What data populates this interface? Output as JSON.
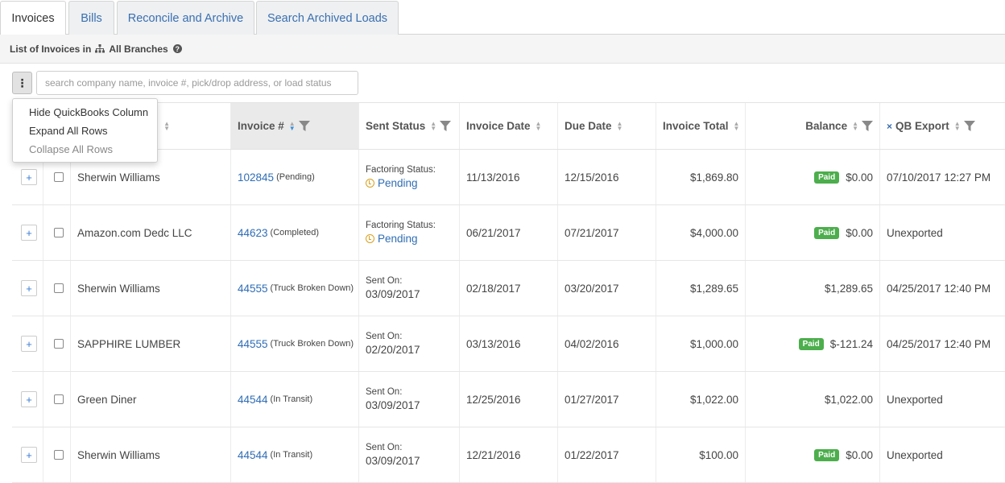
{
  "tabs": [
    {
      "label": "Invoices"
    },
    {
      "label": "Bills"
    },
    {
      "label": "Reconcile and Archive"
    },
    {
      "label": "Search Archived Loads"
    }
  ],
  "subheader": {
    "prefix": "List of Invoices in",
    "scope": "All Branches",
    "help": "?"
  },
  "search": {
    "placeholder": "search company name, invoice #, pick/drop address, or load status"
  },
  "menu_button": {
    "glyph": "⋮"
  },
  "dropdown": {
    "items": [
      {
        "label": "Hide QuickBooks Column"
      },
      {
        "label": "Expand All Rows"
      },
      {
        "label": "Collapse All Rows"
      }
    ]
  },
  "columns": {
    "invoice_num": "Invoice #",
    "sent_status": "Sent Status",
    "invoice_date": "Invoice Date",
    "due_date": "Due Date",
    "invoice_total": "Invoice Total",
    "balance": "Balance",
    "qb_export": "QB Export",
    "qb_remove": "×"
  },
  "rows": [
    {
      "company": "Sherwin Williams",
      "invoice": "102845",
      "invoice_status": "(Pending)",
      "sent_label": "Factoring Status:",
      "sent_value": "Pending",
      "sent_is_pending": true,
      "invoice_date": "11/13/2016",
      "due_date": "12/15/2016",
      "total": "$1,869.80",
      "paid": true,
      "paid_label": "Paid",
      "balance": "$0.00",
      "qb": "07/10/2017 12:27 PM"
    },
    {
      "company": "Amazon.com Dedc LLC",
      "invoice": "44623",
      "invoice_status": "(Completed)",
      "sent_label": "Factoring Status:",
      "sent_value": "Pending",
      "sent_is_pending": true,
      "invoice_date": "06/21/2017",
      "due_date": "07/21/2017",
      "total": "$4,000.00",
      "paid": true,
      "paid_label": "Paid",
      "balance": "$0.00",
      "qb": "Unexported"
    },
    {
      "company": "Sherwin Williams",
      "invoice": "44555",
      "invoice_status": "(Truck Broken Down)",
      "sent_label": "Sent On:",
      "sent_value": "03/09/2017",
      "sent_is_pending": false,
      "invoice_date": "02/18/2017",
      "due_date": "03/20/2017",
      "total": "$1,289.65",
      "paid": false,
      "paid_label": "",
      "balance": "$1,289.65",
      "qb": "04/25/2017 12:40 PM"
    },
    {
      "company": "SAPPHIRE LUMBER",
      "invoice": "44555",
      "invoice_status": "(Truck Broken Down)",
      "sent_label": "Sent On:",
      "sent_value": "02/20/2017",
      "sent_is_pending": false,
      "invoice_date": "03/13/2016",
      "due_date": "04/02/2016",
      "total": "$1,000.00",
      "paid": true,
      "paid_label": "Paid",
      "balance": "$-121.24",
      "qb": "04/25/2017 12:40 PM"
    },
    {
      "company": "Green Diner",
      "invoice": "44544",
      "invoice_status": "(In Transit)",
      "sent_label": "Sent On:",
      "sent_value": "03/09/2017",
      "sent_is_pending": false,
      "invoice_date": "12/25/2016",
      "due_date": "01/27/2017",
      "total": "$1,022.00",
      "paid": false,
      "paid_label": "",
      "balance": "$1,022.00",
      "qb": "Unexported"
    },
    {
      "company": "Sherwin Williams",
      "invoice": "44544",
      "invoice_status": "(In Transit)",
      "sent_label": "Sent On:",
      "sent_value": "03/09/2017",
      "sent_is_pending": false,
      "invoice_date": "12/21/2016",
      "due_date": "01/22/2017",
      "total": "$100.00",
      "paid": true,
      "paid_label": "Paid",
      "balance": "$0.00",
      "qb": "Unexported"
    }
  ],
  "colors": {
    "link": "#2f6db5",
    "paid_badge": "#4cae4c",
    "pending_icon": "#d8a01f"
  }
}
